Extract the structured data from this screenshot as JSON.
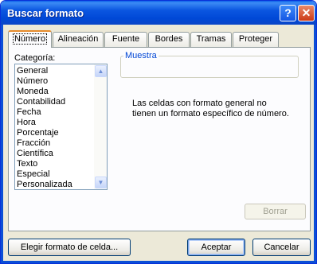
{
  "window": {
    "title": "Buscar formato",
    "help_glyph": "?",
    "close_glyph": "✕"
  },
  "tabs": [
    {
      "label": "Número",
      "active": true
    },
    {
      "label": "Alineación"
    },
    {
      "label": "Fuente"
    },
    {
      "label": "Bordes"
    },
    {
      "label": "Tramas"
    },
    {
      "label": "Proteger"
    }
  ],
  "category": {
    "label": "Categoría:",
    "items": [
      "General",
      "Número",
      "Moneda",
      "Contabilidad",
      "Fecha",
      "Hora",
      "Porcentaje",
      "Fracción",
      "Científica",
      "Texto",
      "Especial",
      "Personalizada"
    ],
    "selected": "General"
  },
  "sample": {
    "label": "Muestra"
  },
  "description": "Las celdas con formato general no tienen un formato específico de número.",
  "buttons": {
    "clear": "Borrar",
    "choose_cell_format": "Elegir formato de celda...",
    "ok": "Aceptar",
    "cancel": "Cancelar"
  },
  "icons": {
    "scroll_up": "▲",
    "scroll_down": "▼"
  },
  "colors": {
    "title_bar": "#0b56e0",
    "dialog_bg": "#ece9d8",
    "active_tab_accent": "#e68b2c",
    "group_title": "#0046d5"
  }
}
